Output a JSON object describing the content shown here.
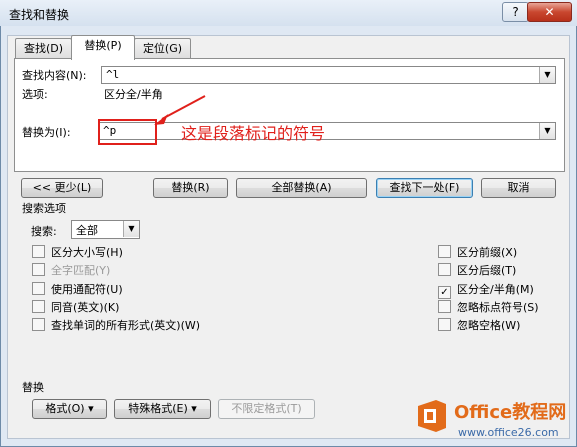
{
  "window": {
    "title": "查找和替换",
    "help": "?",
    "close": "✕"
  },
  "tabs": [
    {
      "label": "查找(D)"
    },
    {
      "label": "替换(P)"
    },
    {
      "label": "定位(G)"
    }
  ],
  "find": {
    "label": "查找内容(N):",
    "value": "^l"
  },
  "options": {
    "label": "选项:",
    "value": "区分全/半角"
  },
  "replace": {
    "label": "替换为(I):",
    "value": "^p"
  },
  "annotation": {
    "text": "这是段落标记的符号",
    "color": "#e0201b"
  },
  "buttons": {
    "less": "<< 更少(L)",
    "replace": "替换(R)",
    "replace_all": "全部替换(A)",
    "find_next": "查找下一处(F)",
    "cancel": "取消"
  },
  "search_options": {
    "heading": "搜索选项",
    "search_label": "搜索:",
    "search_value": "全部",
    "left": [
      {
        "label": "区分大小写(H)",
        "checked": false,
        "disabled": false
      },
      {
        "label": "全字匹配(Y)",
        "checked": false,
        "disabled": true
      },
      {
        "label": "使用通配符(U)",
        "checked": false,
        "disabled": false
      },
      {
        "label": "同音(英文)(K)",
        "checked": false,
        "disabled": false
      },
      {
        "label": "查找单词的所有形式(英文)(W)",
        "checked": false,
        "disabled": false
      }
    ],
    "right": [
      {
        "label": "区分前缀(X)",
        "checked": false,
        "disabled": false
      },
      {
        "label": "区分后缀(T)",
        "checked": false,
        "disabled": false
      },
      {
        "label": "区分全/半角(M)",
        "checked": true,
        "disabled": false
      },
      {
        "label": "忽略标点符号(S)",
        "checked": false,
        "disabled": false
      },
      {
        "label": "忽略空格(W)",
        "checked": false,
        "disabled": false
      }
    ]
  },
  "replace_section": {
    "heading": "替换",
    "format": "格式(O) ▾",
    "special": "特殊格式(E) ▾",
    "no_format": "不限定格式(T)"
  },
  "watermark": {
    "main": "Office教程网",
    "sub": "www.office26.com"
  },
  "colors": {
    "accent": "#3c7fb1",
    "annotation": "#e0201b",
    "brand": "#e26b1a"
  }
}
